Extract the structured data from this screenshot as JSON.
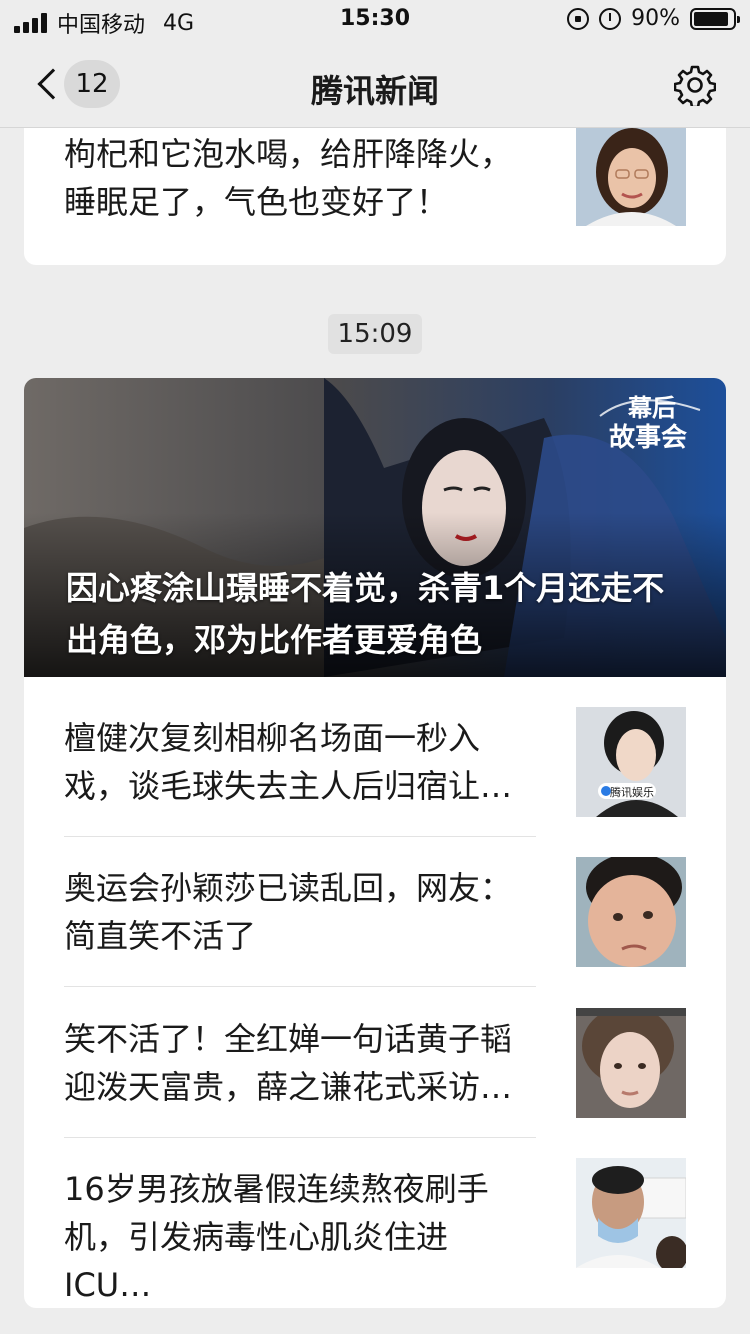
{
  "status_bar": {
    "carrier": "中国移动",
    "network": "4G",
    "time": "15:30",
    "battery_percent": "90%",
    "battery_level": 0.9
  },
  "nav": {
    "unread_count": "12",
    "title": "腾讯新闻"
  },
  "top_article": {
    "title": "枸杞和它泡水喝，给肝降降火，睡眠足了，气色也变好了！"
  },
  "timestamp": "15:09",
  "hero": {
    "badge_line1": "幕后",
    "badge_line2": "故事会",
    "title": "因心疼涂山璟睡不着觉，杀青1个月还走不出角色，邓为比作者更爱角色"
  },
  "articles": [
    {
      "title": "檀健次复刻相柳名场面一秒入戏，谈毛球失去主人后归宿让…"
    },
    {
      "title": "奥运会孙颖莎已读乱回，网友：简直笑不活了"
    },
    {
      "title": "笑不活了！全红婵一句话黄子韬迎泼天富贵，薛之谦花式采访…"
    },
    {
      "title": "16岁男孩放暑假连续熬夜刷手机，引发病毒性心肌炎住进ICU…"
    }
  ],
  "thumb_texts": {
    "article_1_caption": "腾讯娱乐"
  },
  "colors": {
    "background": "#ededed",
    "card": "#ffffff",
    "text": "#1a1a1a"
  }
}
